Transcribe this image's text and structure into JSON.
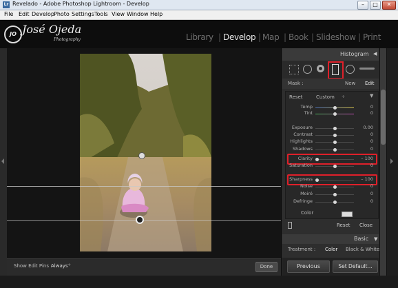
{
  "window": {
    "app_icon": "Lr",
    "title": "Revelado - Adobe Photoshop Lightroom - Develop",
    "minimize": "–",
    "maximize": "□",
    "close": "✕"
  },
  "menu": [
    "File",
    "Edit",
    "Develop",
    "Photo",
    "Settings",
    "Tools",
    "View",
    "Window",
    "Help"
  ],
  "identity": {
    "badge": "JO",
    "name": "José Ojeda",
    "tagline": "Photography"
  },
  "modules": [
    "Library",
    "Develop",
    "Map",
    "Book",
    "Slideshow",
    "Print"
  ],
  "active_module": "Develop",
  "histogram": {
    "title": "Histogram",
    "collapse_icon": "◀"
  },
  "mask": {
    "label": "Mask :",
    "new": "New",
    "edit": "Edit"
  },
  "effect": {
    "reset": "Reset",
    "preset": "Custom",
    "preset_arrow": "÷",
    "collapse_icon": "▼"
  },
  "sliders": [
    {
      "label": "Temp",
      "value": "0",
      "position": 0.5,
      "gradient": "temp"
    },
    {
      "label": "Tint",
      "value": "0",
      "position": 0.5,
      "gradient": "tint"
    },
    {
      "label": "Exposure",
      "value": "0.00",
      "position": 0.5
    },
    {
      "label": "Contrast",
      "value": "0",
      "position": 0.5
    },
    {
      "label": "Highlights",
      "value": "0",
      "position": 0.5
    },
    {
      "label": "Shadows",
      "value": "0",
      "position": 0.5
    },
    {
      "label": "Clarity",
      "value": "– 100",
      "position": 0.0,
      "highlighted": true
    },
    {
      "label": "Saturation",
      "value": "0",
      "position": 0.5
    },
    {
      "label": "Sharpness",
      "value": "– 100",
      "position": 0.0,
      "highlighted": true
    },
    {
      "label": "Noise",
      "value": "0",
      "position": 0.5
    },
    {
      "label": "Moiré",
      "value": "0",
      "position": 0.5
    },
    {
      "label": "Defringe",
      "value": "0",
      "position": 0.5
    }
  ],
  "color_label": "Color",
  "footer": {
    "reset": "Reset",
    "close": "Close"
  },
  "basic": {
    "title": "Basic",
    "collapse_icon": "▼",
    "treatment_label": "Treatment :",
    "color": "Color",
    "bw": "Black & White"
  },
  "buttons": {
    "previous": "Previous",
    "set_default": "Set Default..."
  },
  "toolbar": {
    "pins_label": "Show Edit Pins :",
    "pins_value": "Always",
    "pins_arrows": "÷",
    "done": "Done"
  },
  "colors": {
    "highlight": "#e0202a",
    "panel": "#2e2e2e",
    "background": "#111111"
  }
}
